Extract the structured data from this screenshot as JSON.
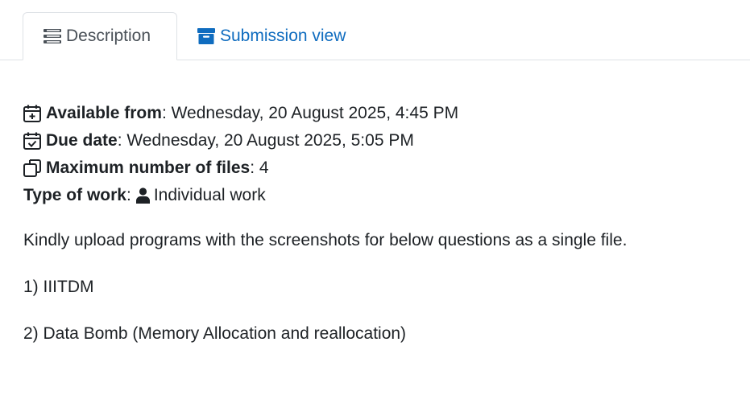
{
  "tabs": [
    {
      "label": "Description",
      "icon": "list-icon",
      "active": true
    },
    {
      "label": "Submission view",
      "icon": "archive-box-icon",
      "active": false
    }
  ],
  "colors": {
    "link": "#0f6cbf",
    "text": "#1d2125",
    "tab_border": "#dee2e6"
  },
  "dates": {
    "available_from": {
      "label": "Available from",
      "sep": ":",
      "value": " Wednesday, 20 August 2025, 4:45 PM",
      "icon": "calendar-plus-icon"
    },
    "due_date": {
      "label": "Due date",
      "sep": ":",
      "value": " Wednesday, 20 August 2025, 5:05 PM",
      "icon": "calendar-check-icon"
    }
  },
  "files": {
    "label": "Maximum number of files",
    "sep": ":",
    "value": " 4",
    "icon": "copy-files-icon"
  },
  "work_type": {
    "label": "Type of work",
    "sep": ":",
    "value": "Individual work",
    "icon": "user-icon"
  },
  "description": [
    "Kindly upload programs with the screenshots for below questions as a single file.",
    "1) IIITDM",
    "2) Data Bomb (Memory Allocation and reallocation)"
  ]
}
